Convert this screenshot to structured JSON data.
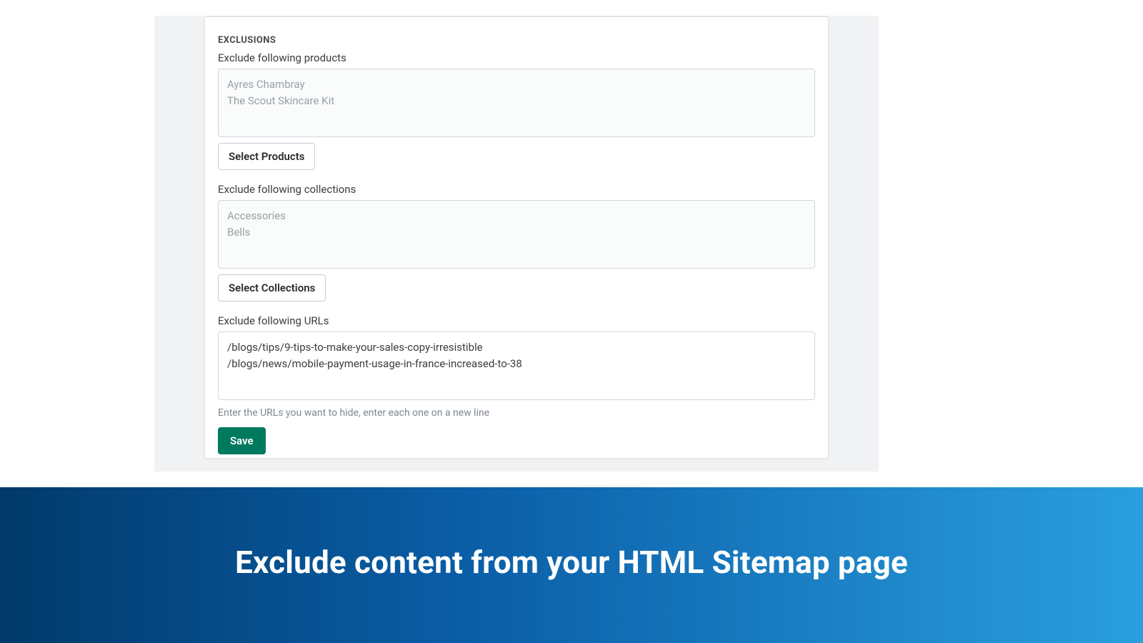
{
  "section": {
    "title": "EXCLUSIONS",
    "products": {
      "label": "Exclude following products",
      "items": [
        "Ayres Chambray",
        "The Scout Skincare Kit"
      ],
      "button": "Select Products"
    },
    "collections": {
      "label": "Exclude following collections",
      "items": [
        "Accessories",
        "Bells"
      ],
      "button": "Select Collections"
    },
    "urls": {
      "label": "Exclude following URLs",
      "items": [
        "/blogs/tips/9-tips-to-make-your-sales-copy-irresistible",
        "/blogs/news/mobile-payment-usage-in-france-increased-to-38"
      ],
      "help": "Enter the URLs you want to hide, enter each one on a new line"
    },
    "save": "Save"
  },
  "banner": {
    "headline": "Exclude content from your HTML Sitemap page"
  }
}
